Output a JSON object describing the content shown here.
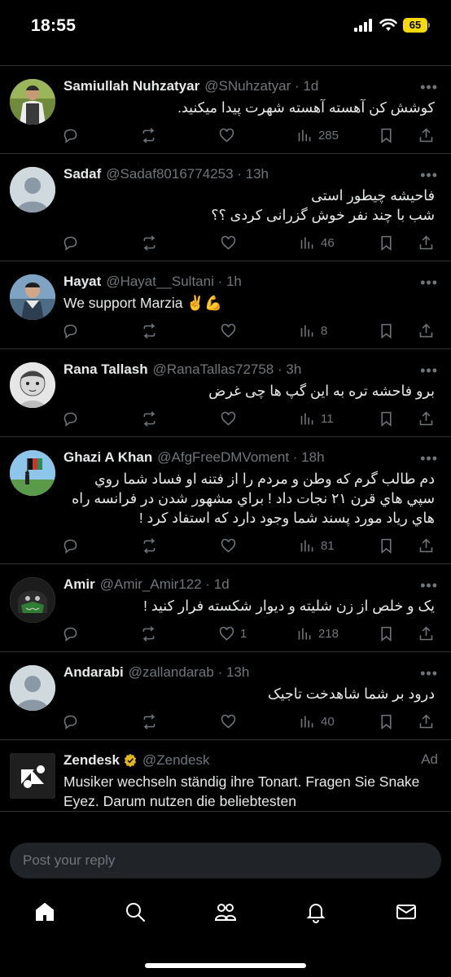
{
  "status_bar": {
    "time": "18:55",
    "battery": "65"
  },
  "tweets": [
    {
      "name": "Samiullah Nuhzatyar",
      "handle": "@SNuhzatyar · 1d",
      "text": "کوشش کن آهسته آهسته شهرت پیدا میکنید.",
      "rtl": true,
      "replies": "",
      "retweets": "",
      "likes": "",
      "views": "285",
      "avatar": "photo-man-green"
    },
    {
      "name": "Sadaf",
      "handle": "@Sadaf8016774253 · 13h",
      "text": "فاحیشه چیطور استی\nشب با چند نفر خوش گزرانی کردی ؟؟",
      "rtl": true,
      "replies": "",
      "retweets": "",
      "likes": "",
      "views": "46",
      "avatar": "default"
    },
    {
      "name": "Hayat",
      "handle": "@Hayat__Sultani · 1h",
      "text": "We support Marzia ✌️💪",
      "rtl": false,
      "replies": "",
      "retweets": "",
      "likes": "",
      "views": "8",
      "avatar": "photo-man-scarf"
    },
    {
      "name": "Rana Tallash",
      "handle": "@RanaTallas72758 · 3h",
      "text": "برو  فاحشه  تره به این گپ ها چی غرض",
      "rtl": true,
      "replies": "",
      "retweets": "",
      "likes": "",
      "views": "11",
      "avatar": "photo-child"
    },
    {
      "name": "Ghazi A Khan",
      "handle": "@AfgFreeDMVoment · 18h",
      "text": "دم طالب گرم که وطن و مردم را از فتنه او فساد شما روي سپي هاي قرن ٢١ نجات داد ! براي مشهور شدن در فرانسه راه هاي رياد مورد پسند شما وجود دارد که استفاد کرد !",
      "rtl": true,
      "replies": "",
      "retweets": "",
      "likes": "",
      "views": "81",
      "avatar": "photo-flag"
    },
    {
      "name": "Amir",
      "handle": "@Amir_Amir122 · 1d",
      "text": "یک و خلص از زن شلیته و دیوار شکسته فرار کنید !",
      "rtl": true,
      "replies": "",
      "retweets": "",
      "likes": "1",
      "views": "218",
      "avatar": "photo-mask"
    },
    {
      "name": "Andarabi",
      "handle": "@zallandarab · 13h",
      "text": "درود بر شما شاهدخت تاجیک",
      "rtl": true,
      "replies": "",
      "retweets": "",
      "likes": "",
      "views": "40",
      "avatar": "default"
    }
  ],
  "ad": {
    "name": "Zendesk",
    "handle": "@Zendesk",
    "badge": "Ad",
    "text": "Musiker wechseln ständig ihre Tonart. Fragen Sie Snake Eyez. Darum nutzen die beliebtesten"
  },
  "reply": {
    "placeholder": "Post your reply"
  },
  "nav": [
    "home-icon",
    "search-icon",
    "communities-icon",
    "notifications-icon",
    "messages-icon"
  ],
  "colors": {
    "background": "#000000",
    "text": "#e7e9ea",
    "muted": "#71767b",
    "divider": "#2f3336",
    "battery": "#f5d90a"
  }
}
